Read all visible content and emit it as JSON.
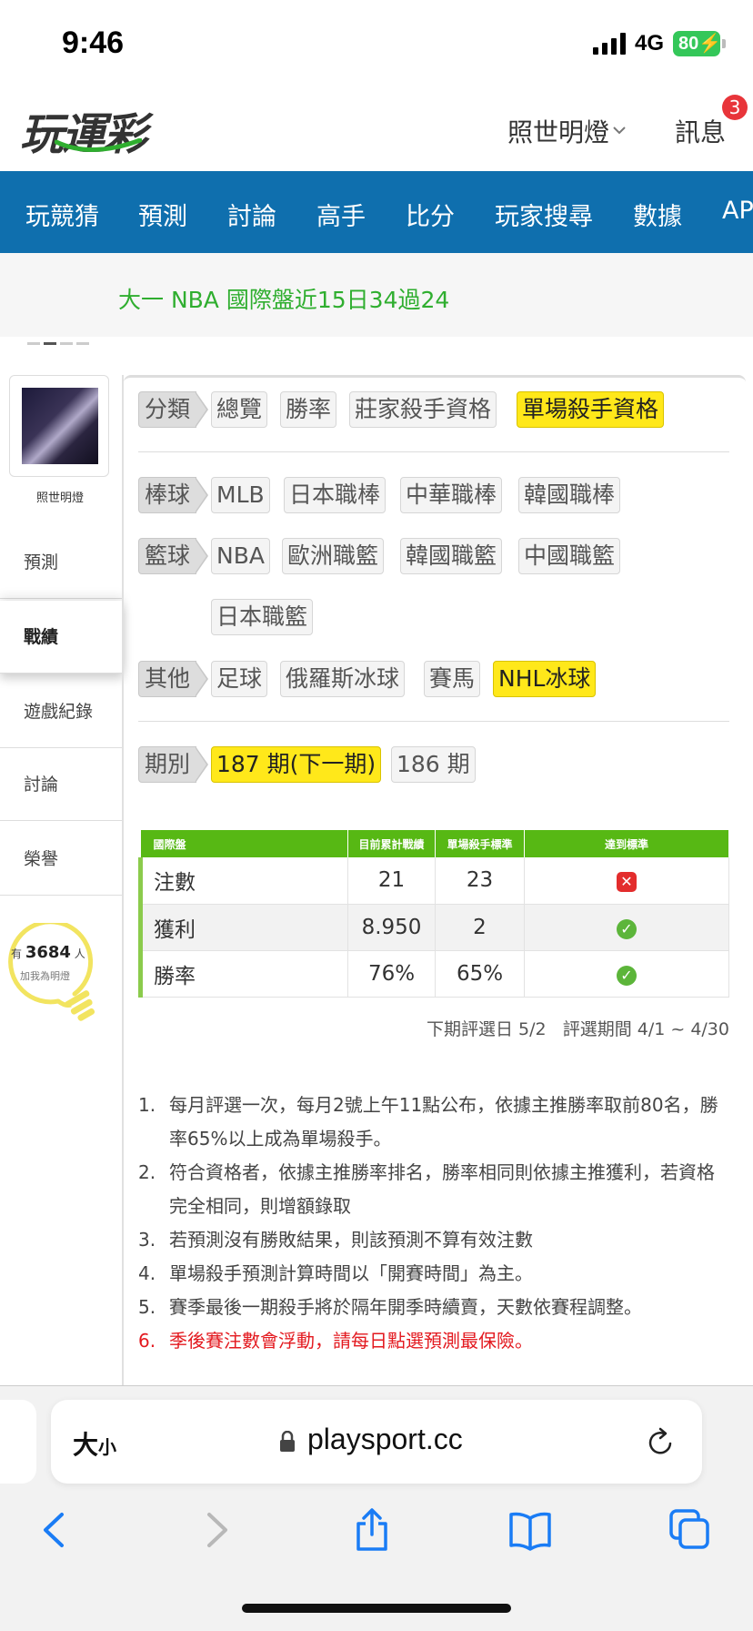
{
  "status_bar": {
    "time": "9:46",
    "network": "4G",
    "battery": "80"
  },
  "header": {
    "logo": "玩運彩",
    "user_name": "照世明燈",
    "messages_label": "訊息",
    "messages_badge": "3"
  },
  "nav": {
    "items": [
      "玩競猜",
      "預測",
      "討論",
      "高手",
      "比分",
      "玩家搜尋",
      "數據",
      "AP"
    ]
  },
  "marquee": {
    "text": "大一 NBA 國際盤近15日34過24"
  },
  "sidebar": {
    "username": "照世明燈",
    "items": [
      "預測",
      "戰績",
      "遊戲紀錄",
      "討論",
      "榮譽"
    ],
    "active_item": "戰績",
    "bulb": {
      "prefix": "有",
      "count": "3684",
      "suffix": "人",
      "subtitle": "加我為明燈"
    }
  },
  "filters": {
    "category": {
      "label": "分類",
      "options": [
        "總覽",
        "勝率",
        "莊家殺手資格",
        "單場殺手資格"
      ],
      "selected": "單場殺手資格"
    },
    "baseball": {
      "label": "棒球",
      "options": [
        "MLB",
        "日本職棒",
        "中華職棒",
        "韓國職棒"
      ]
    },
    "basketball": {
      "label": "籃球",
      "options": [
        "NBA",
        "歐洲職籃",
        "韓國職籃",
        "中國職籃",
        "日本職籃"
      ]
    },
    "other": {
      "label": "其他",
      "options": [
        "足球",
        "俄羅斯冰球",
        "賽馬",
        "NHL冰球"
      ],
      "selected": "NHL冰球"
    },
    "period": {
      "label": "期別",
      "options": [
        "187 期(下一期)",
        "186 期"
      ],
      "selected": "187 期(下一期)"
    }
  },
  "table": {
    "headers": [
      "國際盤",
      "目前累計戰績",
      "單場殺手標準",
      "達到標準"
    ],
    "rows": [
      {
        "label": "注數",
        "current": "21",
        "standard": "23",
        "met": "no"
      },
      {
        "label": "獲利",
        "current": "8.950",
        "standard": "2",
        "met": "yes"
      },
      {
        "label": "勝率",
        "current": "76%",
        "standard": "65%",
        "met": "yes"
      }
    ]
  },
  "evaluation": {
    "next_date": "下期評選日 5/2",
    "period": "評選期間 4/1 ~ 4/30"
  },
  "rules": [
    {
      "num": "1.",
      "text": "每月評選一次，每月2號上午11點公布，依據主推勝率取前80名，勝率65%以上成為單場殺手。"
    },
    {
      "num": "2.",
      "text": "符合資格者，依據主推勝率排名，勝率相同則依據主推獲利，若資格完全相同，則增額錄取"
    },
    {
      "num": "3.",
      "text": "若預測沒有勝敗結果，則該預測不算有效注數"
    },
    {
      "num": "4.",
      "text": "單場殺手預測計算時間以「開賽時間」為主。"
    },
    {
      "num": "5.",
      "text": "賽季最後一期殺手將於隔年開季時續賣，天數依賽程調整。"
    },
    {
      "num": "6.",
      "text": "季後賽注數會浮動，請每日點選預測最保險。",
      "highlight": true
    }
  ],
  "browser": {
    "text_size": "大",
    "text_size_small": "小",
    "url": "playsport.cc"
  },
  "colors": {
    "nav_blue": "#0f6fae",
    "brand_green": "#2fae2f",
    "table_green": "#57b814",
    "highlight_yellow": "#ffe81a",
    "alert_red": "#e3191f"
  }
}
